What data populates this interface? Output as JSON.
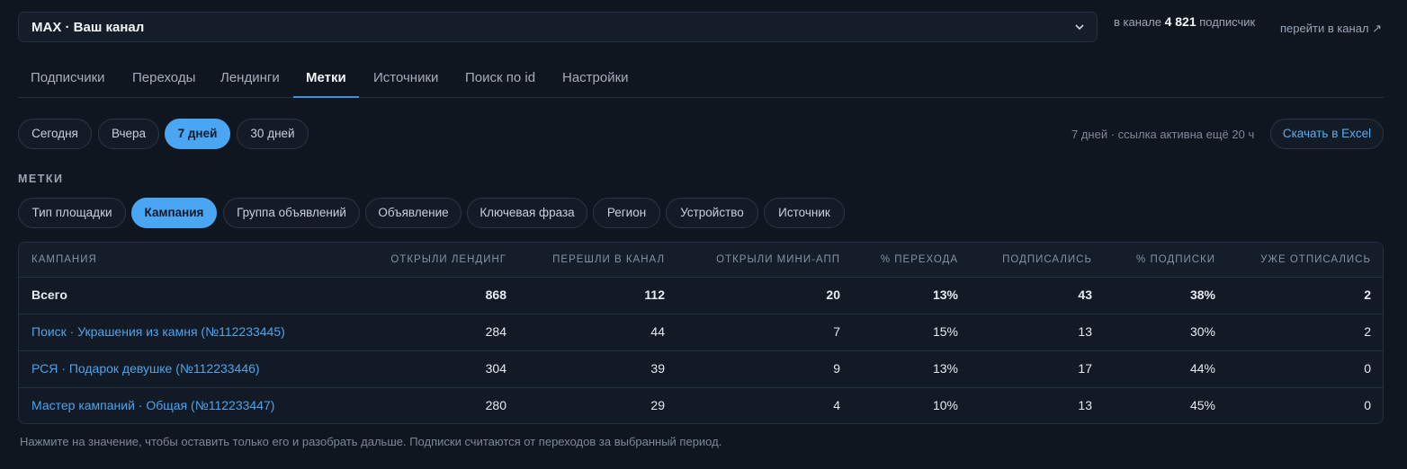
{
  "header": {
    "channel_select_value": "MAX · Ваш канал",
    "subs_prefix": "в канале",
    "subs_count": "4 821",
    "subs_suffix": "подписчик",
    "goto_link": "перейти в канал ↗"
  },
  "tabs": [
    {
      "label": "Подписчики",
      "active": false
    },
    {
      "label": "Переходы",
      "active": false
    },
    {
      "label": "Лендинги",
      "active": false
    },
    {
      "label": "Метки",
      "active": true
    },
    {
      "label": "Источники",
      "active": false
    },
    {
      "label": "Поиск по id",
      "active": false
    },
    {
      "label": "Настройки",
      "active": false
    }
  ],
  "period": {
    "options": [
      {
        "label": "Сегодня",
        "active": false
      },
      {
        "label": "Вчера",
        "active": false
      },
      {
        "label": "7 дней",
        "active": true
      },
      {
        "label": "30 дней",
        "active": false
      }
    ],
    "note": "7 дней · ссылка активна ещё 20 ч",
    "export_label": "Скачать в Excel"
  },
  "section_label": "МЕТКИ",
  "dimensions": [
    {
      "label": "Тип площадки",
      "active": false
    },
    {
      "label": "Кампания",
      "active": true
    },
    {
      "label": "Группа объявлений",
      "active": false
    },
    {
      "label": "Объявление",
      "active": false
    },
    {
      "label": "Ключевая фраза",
      "active": false
    },
    {
      "label": "Регион",
      "active": false
    },
    {
      "label": "Устройство",
      "active": false
    },
    {
      "label": "Источник",
      "active": false
    }
  ],
  "table": {
    "columns": [
      "КАМПАНИЯ",
      "ОТКРЫЛИ ЛЕНДИНГ",
      "ПЕРЕШЛИ В КАНАЛ",
      "ОТКРЫЛИ МИНИ-АПП",
      "% ПЕРЕХОДА",
      "ПОДПИСАЛИСЬ",
      "% ПОДПИСКИ",
      "УЖЕ ОТПИСАЛИСЬ"
    ],
    "total": [
      "Всего",
      "868",
      "112",
      "20",
      "13%",
      "43",
      "38%",
      "2"
    ],
    "rows": [
      [
        "Поиск · Украшения из камня (№112233445)",
        "284",
        "44",
        "7",
        "15%",
        "13",
        "30%",
        "2"
      ],
      [
        "РСЯ · Подарок девушке (№112233446)",
        "304",
        "39",
        "9",
        "13%",
        "17",
        "44%",
        "0"
      ],
      [
        "Мастер кампаний · Общая (№112233447)",
        "280",
        "29",
        "4",
        "10%",
        "13",
        "45%",
        "0"
      ]
    ]
  },
  "footer_note": "Нажмите на значение, чтобы оставить только его и разобрать дальше. Подписки считаются от переходов за выбранный период."
}
